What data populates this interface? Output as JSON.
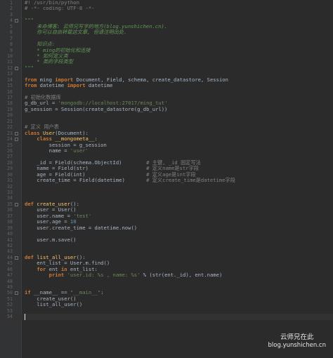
{
  "editor": {
    "lines": [
      {
        "n": "1",
        "segs": [
          [
            "cm",
            "#! /usr/bin/python"
          ]
        ]
      },
      {
        "n": "2",
        "segs": [
          [
            "cm",
            "# -*- coding: UTF-8 -*-"
          ]
        ]
      },
      {
        "n": "3",
        "segs": []
      },
      {
        "n": "4",
        "segs": [
          [
            "doc",
            "\"\"\""
          ]
        ],
        "fold": true
      },
      {
        "n": "5",
        "segs": [
          [
            "doc",
            "    未命博客: 云师兄写字的地方(blog.yunshichen.cn)."
          ]
        ]
      },
      {
        "n": "6",
        "segs": [
          [
            "doc",
            "    你可以自由转载这文章, 但请注明出处."
          ]
        ]
      },
      {
        "n": "7",
        "segs": []
      },
      {
        "n": "8",
        "segs": [
          [
            "doc",
            "    知识点:"
          ]
        ]
      },
      {
        "n": "9",
        "segs": [
          [
            "doc",
            "    * ming的初始化和连接"
          ]
        ]
      },
      {
        "n": "10",
        "segs": [
          [
            "doc",
            "    * 如何定义类"
          ]
        ]
      },
      {
        "n": "11",
        "segs": [
          [
            "doc",
            "    * 类的字段类型"
          ]
        ]
      },
      {
        "n": "12",
        "segs": [
          [
            "doc",
            "\"\"\""
          ]
        ],
        "fold": true
      },
      {
        "n": "13",
        "segs": []
      },
      {
        "n": "14",
        "segs": [
          [
            "kw",
            "from"
          ],
          [
            "",
            " ming "
          ],
          [
            "kw",
            "import"
          ],
          [
            "",
            " Document, Field, schema, create_datastore, Session"
          ]
        ]
      },
      {
        "n": "15",
        "segs": [
          [
            "kw",
            "from"
          ],
          [
            "",
            " datetime "
          ],
          [
            "kw",
            "import"
          ],
          [
            "",
            " datetime"
          ]
        ]
      },
      {
        "n": "16",
        "segs": []
      },
      {
        "n": "17",
        "segs": [
          [
            "cm",
            "# 初始化数据库"
          ]
        ]
      },
      {
        "n": "18",
        "segs": [
          [
            "",
            "g_db_url = "
          ],
          [
            "st",
            "'mongodb://localhost:27017/ming_tut'"
          ]
        ]
      },
      {
        "n": "19",
        "segs": [
          [
            "",
            "g_session = Session(create_datastore(g_db_url))"
          ]
        ]
      },
      {
        "n": "20",
        "segs": []
      },
      {
        "n": "21",
        "segs": []
      },
      {
        "n": "22",
        "segs": [
          [
            "cm",
            "# 定义 用户表"
          ]
        ]
      },
      {
        "n": "23",
        "segs": [
          [
            "kw",
            "class"
          ],
          [
            "cls",
            " User"
          ],
          [
            "",
            "(Document):"
          ]
        ],
        "fold": true
      },
      {
        "n": "24",
        "segs": [
          [
            "",
            "    "
          ],
          [
            "kw",
            "class"
          ],
          [
            "cls",
            " __mongometa__"
          ],
          [
            "",
            ":"
          ]
        ],
        "fold": true
      },
      {
        "n": "25",
        "segs": [
          [
            "",
            "        session = g_session"
          ]
        ]
      },
      {
        "n": "26",
        "segs": [
          [
            "",
            "        name = "
          ],
          [
            "st",
            "'user'"
          ]
        ]
      },
      {
        "n": "27",
        "segs": []
      },
      {
        "n": "28",
        "segs": [
          [
            "",
            "    _id = Field(schema.ObjectId)        "
          ],
          [
            "cm",
            "# 主键, _id 固定写法"
          ]
        ]
      },
      {
        "n": "29",
        "segs": [
          [
            "",
            "    name = Field(str)                   "
          ],
          [
            "cm",
            "# 定义name是str字段"
          ]
        ]
      },
      {
        "n": "30",
        "segs": [
          [
            "",
            "    age = Field(int)                    "
          ],
          [
            "cm",
            "# 定义age是int字段"
          ]
        ]
      },
      {
        "n": "31",
        "segs": [
          [
            "",
            "    create_time = Field(datetime)       "
          ],
          [
            "cm",
            "# 定义create_time是datetime字段"
          ]
        ]
      },
      {
        "n": "32",
        "segs": []
      },
      {
        "n": "33",
        "segs": []
      },
      {
        "n": "34",
        "segs": []
      },
      {
        "n": "35",
        "segs": [
          [
            "kw",
            "def"
          ],
          [
            "fn",
            " create_user"
          ],
          [
            "",
            "():"
          ]
        ],
        "fold": true
      },
      {
        "n": "36",
        "segs": [
          [
            "",
            "    user = User()"
          ]
        ]
      },
      {
        "n": "37",
        "segs": [
          [
            "",
            "    user.name = "
          ],
          [
            "st",
            "'test'"
          ]
        ]
      },
      {
        "n": "38",
        "segs": [
          [
            "",
            "    user.age = "
          ],
          [
            "num",
            "10"
          ]
        ]
      },
      {
        "n": "39",
        "segs": [
          [
            "",
            "    user.create_time = datetime.now()"
          ]
        ]
      },
      {
        "n": "40",
        "segs": []
      },
      {
        "n": "41",
        "segs": [
          [
            "",
            "    user.m.save()"
          ]
        ]
      },
      {
        "n": "42",
        "segs": []
      },
      {
        "n": "43",
        "segs": []
      },
      {
        "n": "44",
        "segs": [
          [
            "kw",
            "def"
          ],
          [
            "fn",
            " list_all_user"
          ],
          [
            "",
            "():"
          ]
        ],
        "fold": true
      },
      {
        "n": "45",
        "segs": [
          [
            "",
            "    ent_list = User.m.find()"
          ]
        ]
      },
      {
        "n": "46",
        "segs": [
          [
            "",
            "    "
          ],
          [
            "kw",
            "for"
          ],
          [
            "",
            " ent "
          ],
          [
            "kw",
            "in"
          ],
          [
            "",
            " ent_list:"
          ]
        ]
      },
      {
        "n": "47",
        "segs": [
          [
            "",
            "        "
          ],
          [
            "kw",
            "print"
          ],
          [
            "",
            " "
          ],
          [
            "st",
            "'user.id: %s , name: %s'"
          ],
          [
            "",
            " % (str(ent._id), ent.name)"
          ]
        ]
      },
      {
        "n": "48",
        "segs": []
      },
      {
        "n": "49",
        "segs": []
      },
      {
        "n": "50",
        "segs": [
          [
            "kw",
            "if"
          ],
          [
            "",
            " __name__ == "
          ],
          [
            "st",
            "\"__main__\""
          ],
          [
            "",
            ":"
          ]
        ],
        "fold": true
      },
      {
        "n": "51",
        "segs": [
          [
            "",
            "    create_user()"
          ]
        ]
      },
      {
        "n": "52",
        "segs": [
          [
            "",
            "    list_all_user()"
          ]
        ]
      },
      {
        "n": "53",
        "segs": []
      },
      {
        "n": "54",
        "segs": [],
        "caret": true
      }
    ]
  },
  "watermark": {
    "line1": "云师兄在此",
    "line2": "blog.yunshichen.cn"
  }
}
